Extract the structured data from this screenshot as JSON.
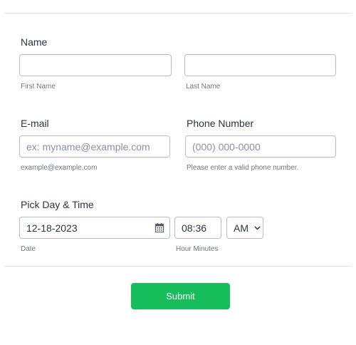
{
  "name": {
    "label": "Name",
    "first_value": "",
    "last_value": "",
    "first_sublabel": "First Name",
    "last_sublabel": "Last Name"
  },
  "email": {
    "label": "E-mail",
    "placeholder": "ex: myname@example.com",
    "sublabel": "example@example.com"
  },
  "phone": {
    "label": "Phone Number",
    "placeholder": "(000) 000-0000",
    "sublabel": "Please enter a valid phone number."
  },
  "datetime": {
    "label": "Pick Day & Time",
    "date_value": "12-18-2023",
    "date_sublabel": "Date",
    "time_value": "08:36",
    "ampm_value": "AM",
    "time_sublabel": "Hour Minutes",
    "calendar_icon": "calendar-icon",
    "dropdown_icon": "chevron-down-icon"
  },
  "submit": {
    "label": "Submit"
  },
  "colors": {
    "submit_bg": "#18bd5b",
    "text": "#2c3345",
    "sublabel": "#6f7686",
    "border": "#b8bdc9",
    "placeholder": "#8d8fa8"
  }
}
